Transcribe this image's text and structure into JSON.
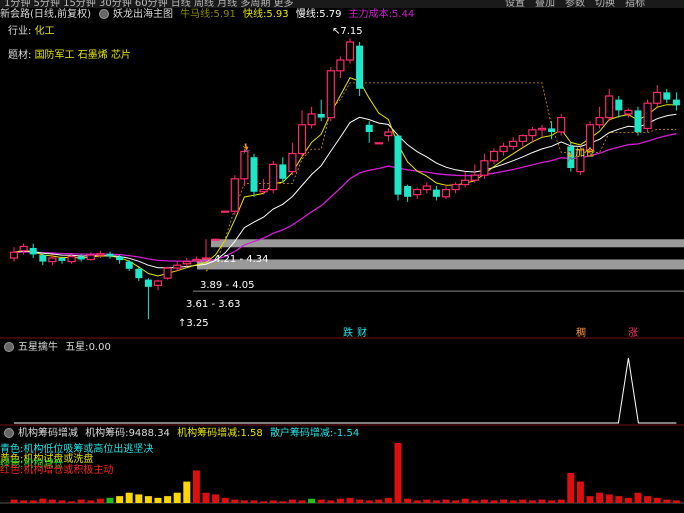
{
  "toolbar": {
    "left_text": "1分钟 5分钟 15分钟 30分钟 60分钟 日线 周线 月线 多周期 更多",
    "buttons": [
      "设置",
      "叠加",
      "参数",
      "切换",
      "指标"
    ]
  },
  "main_panel": {
    "stock": "新会路(日线,前复权)",
    "indicator": "妖龙出海主图",
    "niu_label": "牛马线:",
    "niu_value": "5.91",
    "kuai_label": "快线:",
    "kuai_value": "5.93",
    "man_label": "慢线:",
    "man_value": "5.79",
    "zhuli_label": "主力成本:",
    "zhuli_value": "5.44",
    "industry_label": "行业:",
    "industry_value": "化工",
    "theme_label": "题材:",
    "themes": [
      "国防军工",
      "石墨烯",
      "芯片"
    ],
    "annot_high": "7.15",
    "annot_r1": "4.21 - 4.34",
    "annot_r2": "3.89 - 4.05",
    "annot_r3": "3.61 - 3.63",
    "annot_low": "3.25",
    "annot_jiacang": "加仓",
    "tag_dieta": "跌",
    "tag_cai": "财",
    "tag_chou": "稠",
    "tag_zhang": "涨",
    "colors": {
      "up": "#ff2a6d",
      "down": "#1ee6c8",
      "fast": "#e6e600",
      "slow": "#ffffff",
      "cost": "#d21ed2"
    }
  },
  "five_star": {
    "name": "五星擒牛",
    "label": "五星:",
    "value": "0.00"
  },
  "chip_panel": {
    "name": "机构筹码增减",
    "jg_label": "机构筹码:",
    "jg_value": "9488.34",
    "jgzj_label": "机构筹码增减:",
    "jgzj_value": "1.58",
    "sh_label": "散户筹码增减:",
    "sh_value": "-1.54",
    "signals": [
      {
        "text": "青色:机构低位吸筹或高位出逃坚决",
        "color": "#1ee6e6"
      },
      {
        "text": "黄色:机构试盘或洗盘",
        "color": "#e6e600"
      },
      {
        "text": "绿色:机构减仓",
        "color": "#22dd22"
      },
      {
        "text": "红色:机构增仓或积极主动",
        "color": "#ff2222"
      }
    ]
  },
  "chart_data": {
    "type": "candlestick",
    "candles": [
      {
        "o": 4.1,
        "c": 4.18,
        "h": 4.25,
        "l": 4.05
      },
      {
        "o": 4.2,
        "c": 4.26,
        "h": 4.3,
        "l": 4.15
      },
      {
        "o": 4.24,
        "c": 4.15,
        "h": 4.3,
        "l": 4.1
      },
      {
        "o": 4.14,
        "c": 4.05,
        "h": 4.18,
        "l": 4.0
      },
      {
        "o": 4.05,
        "c": 4.1,
        "h": 4.15,
        "l": 4.0
      },
      {
        "o": 4.1,
        "c": 4.06,
        "h": 4.12,
        "l": 4.02
      },
      {
        "o": 4.05,
        "c": 4.12,
        "h": 4.16,
        "l": 4.02
      },
      {
        "o": 4.12,
        "c": 4.08,
        "h": 4.15,
        "l": 4.05
      },
      {
        "o": 4.08,
        "c": 4.14,
        "h": 4.18,
        "l": 4.06
      },
      {
        "o": 4.14,
        "c": 4.16,
        "h": 4.2,
        "l": 4.1
      },
      {
        "o": 4.16,
        "c": 4.12,
        "h": 4.19,
        "l": 4.09
      },
      {
        "o": 4.12,
        "c": 4.07,
        "h": 4.14,
        "l": 4.02
      },
      {
        "o": 4.05,
        "c": 3.95,
        "h": 4.07,
        "l": 3.92
      },
      {
        "o": 3.95,
        "c": 3.82,
        "h": 3.97,
        "l": 3.78
      },
      {
        "o": 3.8,
        "c": 3.7,
        "h": 3.82,
        "l": 3.25
      },
      {
        "o": 3.72,
        "c": 3.78,
        "h": 3.8,
        "l": 3.65
      },
      {
        "o": 3.82,
        "c": 3.96,
        "h": 3.98,
        "l": 3.8
      },
      {
        "o": 3.96,
        "c": 4.0,
        "h": 4.05,
        "l": 3.92
      },
      {
        "o": 4.02,
        "c": 4.05,
        "h": 4.1,
        "l": 3.98
      },
      {
        "o": 4.06,
        "c": 4.08,
        "h": 4.12,
        "l": 4.04
      },
      {
        "o": 4.1,
        "c": 4.1,
        "h": 4.36,
        "l": 4.1
      },
      {
        "o": 4.36,
        "c": 4.36,
        "h": 4.36,
        "l": 4.36
      },
      {
        "o": 4.75,
        "c": 4.75,
        "h": 4.75,
        "l": 4.75
      },
      {
        "o": 4.75,
        "c": 5.2,
        "h": 5.25,
        "l": 4.7
      },
      {
        "o": 5.2,
        "c": 5.58,
        "h": 5.62,
        "l": 5.1
      },
      {
        "o": 5.5,
        "c": 5.02,
        "h": 5.55,
        "l": 4.95
      },
      {
        "o": 5.02,
        "c": 5.05,
        "h": 5.2,
        "l": 4.98
      },
      {
        "o": 5.05,
        "c": 5.4,
        "h": 5.45,
        "l": 5.0
      },
      {
        "o": 5.4,
        "c": 5.2,
        "h": 5.5,
        "l": 5.15
      },
      {
        "o": 5.3,
        "c": 5.55,
        "h": 5.7,
        "l": 5.25
      },
      {
        "o": 5.55,
        "c": 5.95,
        "h": 6.15,
        "l": 5.5
      },
      {
        "o": 5.95,
        "c": 6.1,
        "h": 6.2,
        "l": 5.9
      },
      {
        "o": 6.1,
        "c": 6.05,
        "h": 6.3,
        "l": 6.0
      },
      {
        "o": 6.05,
        "c": 6.7,
        "h": 6.75,
        "l": 6.0
      },
      {
        "o": 6.7,
        "c": 6.85,
        "h": 6.9,
        "l": 6.6
      },
      {
        "o": 6.85,
        "c": 7.1,
        "h": 7.15,
        "l": 6.8
      },
      {
        "o": 7.05,
        "c": 6.45,
        "h": 7.1,
        "l": 6.35
      },
      {
        "o": 5.95,
        "c": 5.85,
        "h": 6.0,
        "l": 5.7
      },
      {
        "o": 5.7,
        "c": 5.7,
        "h": 5.7,
        "l": 5.7
      },
      {
        "o": 5.8,
        "c": 5.85,
        "h": 5.9,
        "l": 5.72
      },
      {
        "o": 5.8,
        "c": 4.98,
        "h": 5.05,
        "l": 4.9
      },
      {
        "o": 5.1,
        "c": 4.95,
        "h": 5.12,
        "l": 4.88
      },
      {
        "o": 4.98,
        "c": 5.05,
        "h": 5.08,
        "l": 4.92
      },
      {
        "o": 5.05,
        "c": 5.1,
        "h": 5.15,
        "l": 5.0
      },
      {
        "o": 5.05,
        "c": 4.95,
        "h": 5.1,
        "l": 4.9
      },
      {
        "o": 4.95,
        "c": 5.05,
        "h": 5.12,
        "l": 4.92
      },
      {
        "o": 5.05,
        "c": 5.12,
        "h": 5.15,
        "l": 5.0
      },
      {
        "o": 5.12,
        "c": 5.18,
        "h": 5.3,
        "l": 5.08
      },
      {
        "o": 5.18,
        "c": 5.25,
        "h": 5.4,
        "l": 5.15
      },
      {
        "o": 5.25,
        "c": 5.45,
        "h": 5.55,
        "l": 5.2
      },
      {
        "o": 5.45,
        "c": 5.58,
        "h": 5.62,
        "l": 5.4
      },
      {
        "o": 5.58,
        "c": 5.65,
        "h": 5.7,
        "l": 5.52
      },
      {
        "o": 5.65,
        "c": 5.72,
        "h": 5.78,
        "l": 5.6
      },
      {
        "o": 5.72,
        "c": 5.8,
        "h": 5.82,
        "l": 5.65
      },
      {
        "o": 5.8,
        "c": 5.88,
        "h": 5.92,
        "l": 5.7
      },
      {
        "o": 5.88,
        "c": 5.9,
        "h": 5.95,
        "l": 5.78
      },
      {
        "o": 5.9,
        "c": 5.85,
        "h": 6.0,
        "l": 5.75
      },
      {
        "o": 5.85,
        "c": 6.05,
        "h": 6.1,
        "l": 5.8
      },
      {
        "o": 5.65,
        "c": 5.35,
        "h": 5.7,
        "l": 5.3
      },
      {
        "o": 5.3,
        "c": 5.6,
        "h": 5.65,
        "l": 5.25
      },
      {
        "o": 5.6,
        "c": 5.95,
        "h": 6.0,
        "l": 5.55
      },
      {
        "o": 5.95,
        "c": 6.05,
        "h": 6.2,
        "l": 5.9
      },
      {
        "o": 6.05,
        "c": 6.35,
        "h": 6.45,
        "l": 6.0
      },
      {
        "o": 6.3,
        "c": 6.15,
        "h": 6.35,
        "l": 6.05
      },
      {
        "o": 6.1,
        "c": 6.15,
        "h": 6.18,
        "l": 6.05
      },
      {
        "o": 6.15,
        "c": 5.85,
        "h": 6.2,
        "l": 5.8
      },
      {
        "o": 5.9,
        "c": 6.25,
        "h": 6.3,
        "l": 5.85
      },
      {
        "o": 6.25,
        "c": 6.4,
        "h": 6.5,
        "l": 6.2
      },
      {
        "o": 6.4,
        "c": 6.3,
        "h": 6.45,
        "l": 6.25
      },
      {
        "o": 6.3,
        "c": 6.22,
        "h": 6.4,
        "l": 6.15
      }
    ],
    "five_star_values": [
      0,
      0,
      0,
      0,
      0,
      0,
      0,
      0,
      0,
      0,
      0,
      0,
      0,
      0,
      0,
      0,
      0,
      0,
      0,
      0,
      0,
      0,
      0,
      0,
      0,
      0,
      0,
      0,
      0,
      0,
      0,
      0,
      0,
      0,
      0,
      0,
      0,
      0,
      0,
      0,
      0,
      0,
      0,
      0,
      0,
      0,
      0,
      0,
      0,
      0,
      0,
      0,
      0,
      0,
      0,
      0,
      0,
      0,
      0,
      0,
      0,
      0,
      0,
      0,
      0,
      0,
      0,
      0,
      0,
      0
    ],
    "five_star_peak_index": 64,
    "chip_bars": [
      {
        "v": 4,
        "c": "r"
      },
      {
        "v": 3,
        "c": "r"
      },
      {
        "v": 3,
        "c": "r"
      },
      {
        "v": 5,
        "c": "r"
      },
      {
        "v": 4,
        "c": "r"
      },
      {
        "v": 3,
        "c": "r"
      },
      {
        "v": 2,
        "c": "r"
      },
      {
        "v": 4,
        "c": "r"
      },
      {
        "v": 3,
        "c": "r"
      },
      {
        "v": 5,
        "c": "r"
      },
      {
        "v": 6,
        "c": "g"
      },
      {
        "v": 8,
        "c": "y"
      },
      {
        "v": 12,
        "c": "y"
      },
      {
        "v": 10,
        "c": "y"
      },
      {
        "v": 8,
        "c": "y"
      },
      {
        "v": 6,
        "c": "y"
      },
      {
        "v": 8,
        "c": "y"
      },
      {
        "v": 12,
        "c": "y"
      },
      {
        "v": 25,
        "c": "y"
      },
      {
        "v": 38,
        "c": "r"
      },
      {
        "v": 12,
        "c": "r"
      },
      {
        "v": 10,
        "c": "r"
      },
      {
        "v": 6,
        "c": "r"
      },
      {
        "v": 4,
        "c": "r"
      },
      {
        "v": 3,
        "c": "r"
      },
      {
        "v": 3,
        "c": "r"
      },
      {
        "v": 2,
        "c": "r"
      },
      {
        "v": 3,
        "c": "r"
      },
      {
        "v": 2,
        "c": "r"
      },
      {
        "v": 4,
        "c": "r"
      },
      {
        "v": 3,
        "c": "r"
      },
      {
        "v": 5,
        "c": "g"
      },
      {
        "v": 4,
        "c": "r"
      },
      {
        "v": 3,
        "c": "r"
      },
      {
        "v": 5,
        "c": "r"
      },
      {
        "v": 6,
        "c": "r"
      },
      {
        "v": 4,
        "c": "r"
      },
      {
        "v": 3,
        "c": "r"
      },
      {
        "v": 4,
        "c": "r"
      },
      {
        "v": 6,
        "c": "r"
      },
      {
        "v": 70,
        "c": "r"
      },
      {
        "v": 5,
        "c": "r"
      },
      {
        "v": 3,
        "c": "r"
      },
      {
        "v": 4,
        "c": "r"
      },
      {
        "v": 3,
        "c": "r"
      },
      {
        "v": 4,
        "c": "r"
      },
      {
        "v": 3,
        "c": "r"
      },
      {
        "v": 5,
        "c": "r"
      },
      {
        "v": 3,
        "c": "r"
      },
      {
        "v": 4,
        "c": "r"
      },
      {
        "v": 3,
        "c": "r"
      },
      {
        "v": 4,
        "c": "r"
      },
      {
        "v": 3,
        "c": "r"
      },
      {
        "v": 4,
        "c": "r"
      },
      {
        "v": 3,
        "c": "r"
      },
      {
        "v": 4,
        "c": "r"
      },
      {
        "v": 3,
        "c": "r"
      },
      {
        "v": 4,
        "c": "r"
      },
      {
        "v": 35,
        "c": "r"
      },
      {
        "v": 25,
        "c": "r"
      },
      {
        "v": 8,
        "c": "r"
      },
      {
        "v": 12,
        "c": "r"
      },
      {
        "v": 10,
        "c": "r"
      },
      {
        "v": 8,
        "c": "r"
      },
      {
        "v": 6,
        "c": "r"
      },
      {
        "v": 12,
        "c": "r"
      },
      {
        "v": 8,
        "c": "r"
      },
      {
        "v": 6,
        "c": "r"
      },
      {
        "v": 4,
        "c": "r"
      },
      {
        "v": 3,
        "c": "r"
      }
    ],
    "price_range": [
      3.1,
      7.35
    ]
  }
}
